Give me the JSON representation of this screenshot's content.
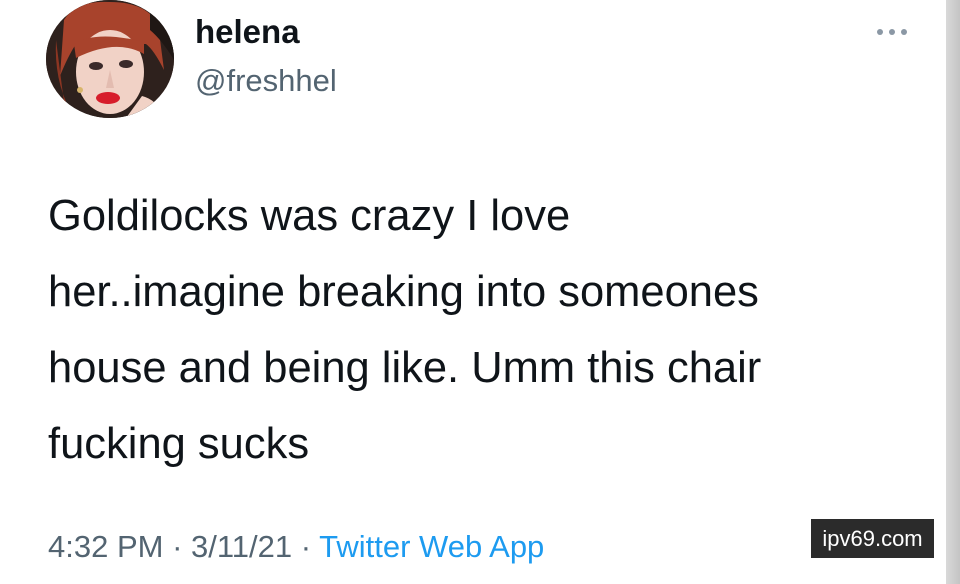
{
  "user": {
    "display_name": "helena",
    "handle": "@freshhel",
    "avatar_icon": "profile-photo"
  },
  "tweet": {
    "lines": [
      "Goldilocks was crazy I love",
      "her..imagine breaking into someones",
      "house and being like. Umm this chair",
      "fucking sucks"
    ],
    "time": "4:32 PM",
    "separator": " · ",
    "date": "3/11/21",
    "source": "Twitter Web App"
  },
  "controls": {
    "more_icon": "more-horizontal-icon"
  },
  "watermark": {
    "text": "ipv69.com"
  },
  "colors": {
    "text_primary": "#0f1419",
    "text_secondary": "#536471",
    "link": "#1d9bf0",
    "watermark_bg": "#2b2b2b"
  }
}
